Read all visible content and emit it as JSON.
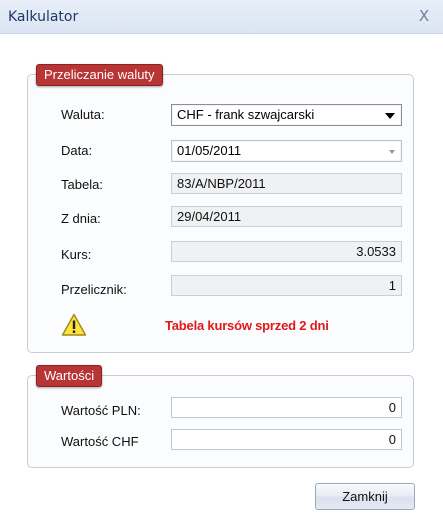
{
  "window": {
    "title": "Kalkulator",
    "close_glyph": "X"
  },
  "conversion": {
    "legend": "Przeliczanie waluty",
    "currency_label": "Waluta:",
    "currency_value": "CHF - frank szwajcarski",
    "date_label": "Data:",
    "date_value": "01/05/2011",
    "table_label": "Tabela:",
    "table_value": "83/A/NBP/2011",
    "from_date_label": "Z dnia:",
    "from_date_value": "29/04/2011",
    "rate_label": "Kurs:",
    "rate_value": "3.0533",
    "multiplier_label": "Przelicznik:",
    "multiplier_value": "1",
    "warning_text": "Tabela kursów sprzed 2 dni",
    "warning_icon": "warning-icon",
    "warning_color": "#e0191a"
  },
  "values": {
    "legend": "Wartości",
    "pln_label": "Wartość PLN:",
    "pln_value": "0",
    "foreign_label": "Wartość CHF",
    "foreign_value": "0"
  },
  "buttons": {
    "close_label": "Zamknij"
  },
  "colors": {
    "legend_bg": "#b83536",
    "titlebar": "#dbe5f3"
  }
}
